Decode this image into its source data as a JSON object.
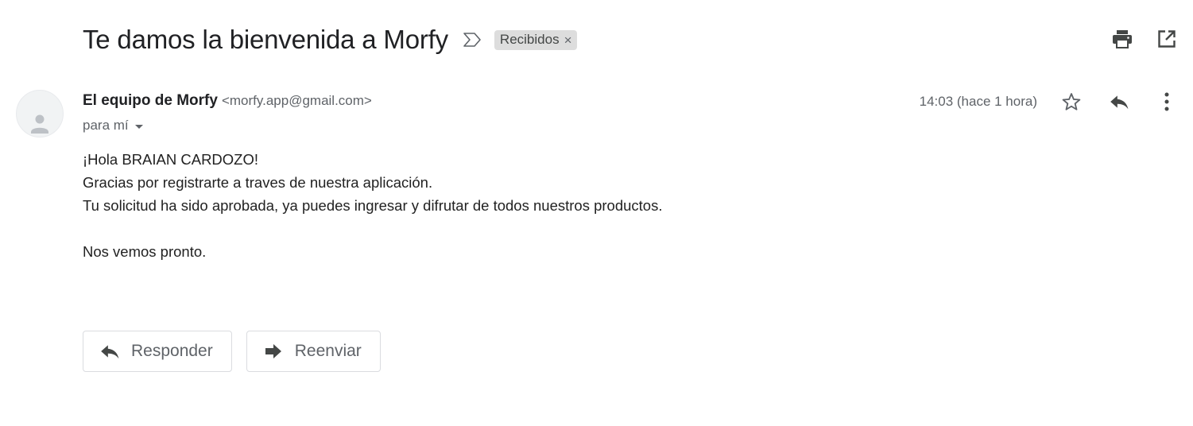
{
  "message": {
    "subject": "Te damos la bienvenida a Morfy",
    "label": "Recibidos",
    "label_remove": "×"
  },
  "sender": {
    "name": "El equipo de Morfy",
    "email": "<morfy.app@gmail.com>",
    "recipient": "para mí",
    "timestamp": "14:03 (hace 1 hora)"
  },
  "body": {
    "lines": [
      "¡Hola BRAIAN CARDOZO!",
      "Gracias por registrarte a traves de nuestra aplicación.",
      "Tu solicitud ha sido aprobada, ya puedes ingresar y difrutar de todos nuestros productos.",
      "",
      "Nos vemos pronto."
    ]
  },
  "actions": {
    "reply_label": "Responder",
    "forward_label": "Reenviar"
  },
  "icons": {
    "importance": "importance-marker-icon",
    "print": "print-icon",
    "new_window": "open-in-new-window-icon",
    "avatar": "default-avatar-icon",
    "star": "star-outline-icon",
    "reply": "reply-icon",
    "more": "more-vert-icon",
    "forward": "forward-icon"
  },
  "colors": {
    "text_primary": "#202124",
    "text_secondary": "#5f6368",
    "chip_bg": "#dddddd",
    "button_border": "#dadce0",
    "icon_dark": "#444746"
  }
}
